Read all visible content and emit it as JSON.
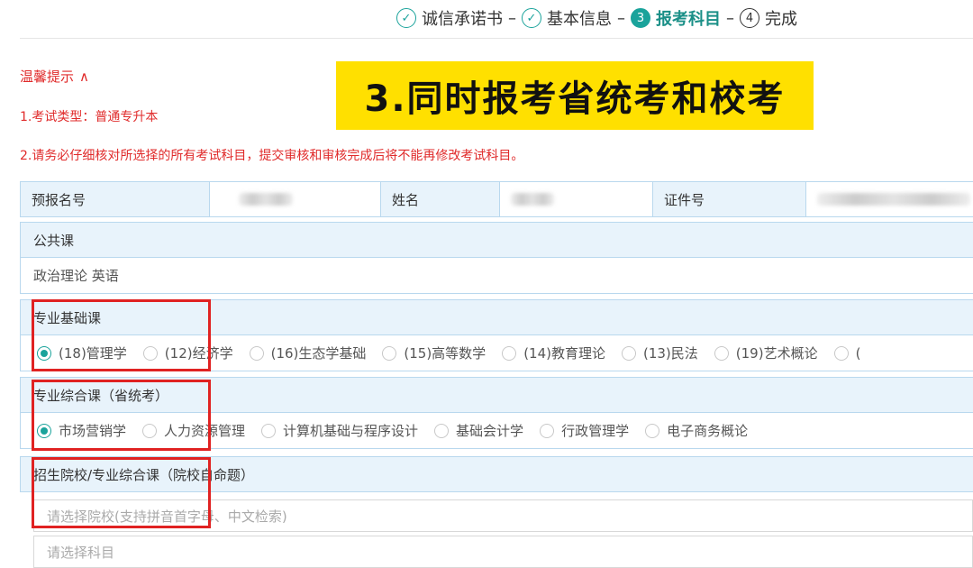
{
  "stepper": {
    "steps": [
      {
        "label": "诚信承诺书",
        "marker": "check-icon"
      },
      {
        "label": "基本信息",
        "marker": "check-icon"
      },
      {
        "label": "报考科目",
        "number": "3"
      },
      {
        "label": "完成",
        "number": "4"
      }
    ],
    "separator": "–"
  },
  "tips": {
    "title": "温馨提示",
    "toggle": "∧",
    "line1": "1.考试类型：普通专升本",
    "line2": "2.请务必仔细核对所选择的所有考试科目，提交审核和审核完成后将不能再修改考试科目。"
  },
  "banner": {
    "text": "3.同时报考省统考和校考"
  },
  "info": {
    "id_label": "预报名号",
    "name_label": "姓名",
    "cert_label": "证件号"
  },
  "public": {
    "title": "公共课",
    "subjects": "政治理论 英语"
  },
  "basic": {
    "title": "专业基础课",
    "options": [
      {
        "label": "(18)管理学",
        "selected": true
      },
      {
        "label": "(12)经济学",
        "selected": false
      },
      {
        "label": "(16)生态学基础",
        "selected": false
      },
      {
        "label": "(15)高等数学",
        "selected": false
      },
      {
        "label": "(14)教育理论",
        "selected": false
      },
      {
        "label": "(13)民法",
        "selected": false
      },
      {
        "label": "(19)艺术概论",
        "selected": false
      },
      {
        "label": "(",
        "selected": false
      }
    ]
  },
  "comprehensive": {
    "title": "专业综合课（省统考）",
    "options": [
      {
        "label": "市场营销学",
        "selected": true
      },
      {
        "label": "人力资源管理",
        "selected": false
      },
      {
        "label": "计算机基础与程序设计",
        "selected": false
      },
      {
        "label": "基础会计学",
        "selected": false
      },
      {
        "label": "行政管理学",
        "selected": false
      },
      {
        "label": "电子商务概论",
        "selected": false
      }
    ]
  },
  "school": {
    "title": "招生院校/专业综合课（院校自命题）",
    "school_placeholder": "请选择院校(支持拼音首字母、中文检索)",
    "subject_placeholder": "请选择科目"
  },
  "colors": {
    "accent": "#1aa39b",
    "tip": "#e02b2b",
    "highlight": "#ffe000",
    "annotation": "#e02222"
  }
}
